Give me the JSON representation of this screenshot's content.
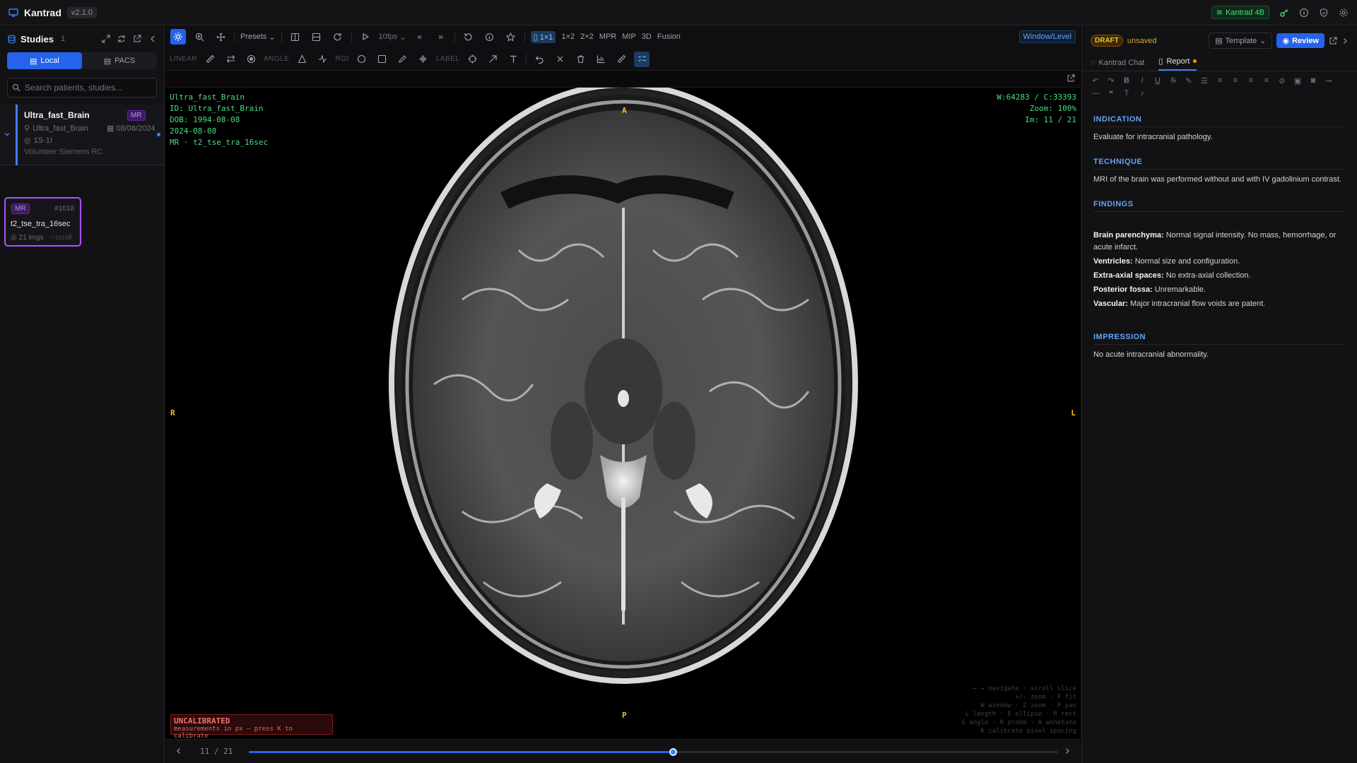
{
  "app": {
    "name": "Kantrad",
    "version": "v2.1.0",
    "ai_badge": "Kantrad 4B"
  },
  "sidebar": {
    "title": "Studies",
    "count": "1",
    "tabs": [
      {
        "label": "Local"
      },
      {
        "label": "PACS"
      }
    ],
    "search_placeholder": "Search patients, studies...",
    "study": {
      "name": "Ultra_fast_Brain",
      "modality": "MR",
      "patient_id": "Ultra_fast_Brain",
      "date": "08/08/2024",
      "series_count": "1S·1I",
      "institution": "Volunteer Siemens RC"
    },
    "series": {
      "modality": "MR",
      "number": "#1018",
      "name": "t2_tse_tra_16sec",
      "images": "21 imgs",
      "scroll_hint": "scroll"
    }
  },
  "toolbar": {
    "presets": "Presets",
    "fps": "10fps",
    "layouts": [
      "1×1",
      "1×2",
      "2×2"
    ],
    "modes": [
      "MPR",
      "MIP",
      "3D",
      "Fusion"
    ],
    "window_level": "Window/Level",
    "groups": {
      "linear": "LINEAR",
      "angle": "ANGLE",
      "roi": "ROI",
      "label": "LABEL"
    }
  },
  "viewer": {
    "overlay_tl": [
      "Ultra_fast_Brain",
      "ID: Ultra_fast_Brain",
      "DOB: 1994-08-08",
      "2024-08-08",
      "MR · t2_tse_tra_16sec"
    ],
    "overlay_tr": [
      "W:64283 / C:33393",
      "Zoom: 100%",
      "Im: 11 / 21"
    ],
    "orient": {
      "top": "A",
      "bottom": "P",
      "left": "R",
      "right": "L"
    },
    "uncal_title": "UNCALIBRATED",
    "uncal_sub": "measurements in px — press K to calibrate",
    "hints": [
      "← → navigate · scroll slice",
      "+/- zoom · F fit",
      "W window · Z zoom · P pan",
      "L length · E ellipse · R rect",
      "G angle · H probe · A annotate",
      "K calibrate pixel spacing"
    ],
    "slice_label": "11 / 21",
    "slice_current": 11,
    "slice_total": 21
  },
  "report": {
    "status": "DRAFT",
    "saved_state": "unsaved",
    "template_label": "Template",
    "review_label": "Review",
    "tabs": [
      {
        "label": "Kantrad Chat"
      },
      {
        "label": "Report"
      }
    ],
    "indication_h": "INDICATION",
    "indication": "Evaluate for intracranial pathology.",
    "technique_h": "TECHNIQUE",
    "technique": "MRI of the brain was performed without and with IV gadolinium contrast.",
    "findings_h": "FINDINGS",
    "findings": [
      {
        "k": "Brain parenchyma:",
        "v": " Normal signal intensity. No mass, hemorrhage, or acute infarct."
      },
      {
        "k": "Ventricles:",
        "v": " Normal size and configuration."
      },
      {
        "k": "Extra-axial spaces:",
        "v": " No extra-axial collection."
      },
      {
        "k": "Posterior fossa:",
        "v": " Unremarkable."
      },
      {
        "k": "Vascular:",
        "v": " Major intracranial flow voids are patent."
      }
    ],
    "impression_h": "IMPRESSION",
    "impression": "No acute intracranial abnormality."
  },
  "colors": {
    "accent": "#2563eb",
    "overlay_green": "#4ade80",
    "orient": "#fbbf24",
    "draft": "#fbbf24",
    "mr_purple": "#a855f7"
  }
}
